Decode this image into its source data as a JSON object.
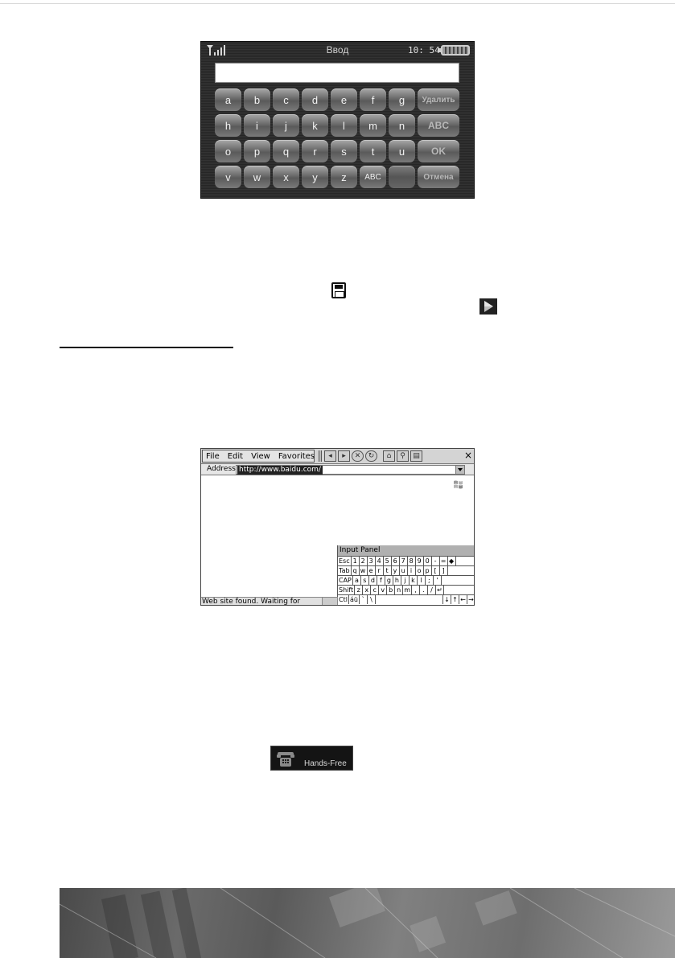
{
  "keyboard_screen": {
    "title": "Ввод",
    "time": "10: 54",
    "rows": [
      [
        "a",
        "b",
        "c",
        "d",
        "e",
        "f",
        "g"
      ],
      [
        "h",
        "i",
        "j",
        "k",
        "l",
        "m",
        "n"
      ],
      [
        "o",
        "p",
        "q",
        "r",
        "s",
        "t",
        "u"
      ],
      [
        "v",
        "w",
        "x",
        "y",
        "z",
        "ABC",
        ""
      ]
    ],
    "actions": [
      "Удалить",
      "ABC",
      "OK",
      "Отмена"
    ],
    "icons": {
      "signal": "signal-strength-icon",
      "battery": "battery-icon"
    }
  },
  "inline_icons": [
    "floppy-disk-icon",
    "play-arrow-icon"
  ],
  "browser_screen": {
    "menu": [
      "File",
      "Edit",
      "View",
      "Favorites"
    ],
    "address_label": "Address",
    "address_value": "http://www.baidu.com/",
    "status": "Web site found. Waiting for reply...",
    "close": "×",
    "input_panel": {
      "title": "Input Panel",
      "rows": [
        [
          "Esc",
          "1",
          "2",
          "3",
          "4",
          "5",
          "6",
          "7",
          "8",
          "9",
          "0",
          "-",
          "=",
          "◆"
        ],
        [
          "Tab",
          "q",
          "w",
          "e",
          "r",
          "t",
          "y",
          "u",
          "i",
          "o",
          "p",
          "[",
          "]"
        ],
        [
          "CAP",
          "a",
          "s",
          "d",
          "f",
          "g",
          "h",
          "j",
          "k",
          "l",
          ";",
          "'"
        ],
        [
          "Shift",
          "z",
          "x",
          "c",
          "v",
          "b",
          "n",
          "m",
          ",",
          ".",
          "/",
          "↵"
        ],
        [
          "Ctl",
          "áü",
          "`",
          "\\",
          "",
          "↓",
          "↑",
          "←",
          "→"
        ]
      ]
    }
  },
  "handsfree_badge": {
    "label": "Hands-Free",
    "icon": "telephone-icon"
  }
}
